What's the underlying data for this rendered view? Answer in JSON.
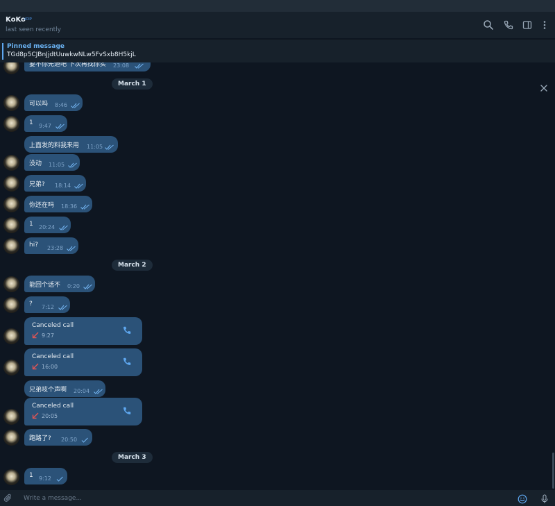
{
  "header": {
    "name": "KoKo",
    "badge": "VOIP",
    "status": "last seen recently"
  },
  "pinned": {
    "title": "Pinned message",
    "text": "TGd8p5CJBnJjdtUuwkwNLw5FvSxb8H5kjL"
  },
  "dates": [
    "March 1",
    "March 2",
    "March 3"
  ],
  "messages": [
    {
      "text": "要不你先退吧 下次再找你买",
      "time": "23:08"
    },
    {
      "text": "可以吗",
      "time": "8:46"
    },
    {
      "text": "1",
      "time": "9:47"
    },
    {
      "text": "上面发的料我来用",
      "time": "11:05"
    },
    {
      "text": "没动",
      "time": "11:05"
    },
    {
      "text": "兄弟?",
      "time": "18:14"
    },
    {
      "text": "你还在吗",
      "time": "18:36"
    },
    {
      "text": "1",
      "time": "20:24"
    },
    {
      "text": "hi?",
      "time": "23:28"
    },
    {
      "text": "能回个话不",
      "time": "0:20"
    },
    {
      "text": "?",
      "time": "7:12"
    },
    {
      "text": "兄弟吱个声啊",
      "time": "20:04"
    },
    {
      "text": "跑路了?",
      "time": "20:50"
    },
    {
      "text": "1",
      "time": "9:12"
    }
  ],
  "calls": [
    {
      "label": "Canceled call",
      "time": "9:27"
    },
    {
      "label": "Canceled call",
      "time": "16:00"
    },
    {
      "label": "Canceled call",
      "time": "20:05"
    }
  ],
  "composer": {
    "placeholder": "Write a message..."
  },
  "icons": {
    "search": "search-icon",
    "phone": "phone-icon",
    "sidebar": "sidebar-toggle-icon",
    "menu": "more-vertical-icon",
    "close": "close-icon",
    "attach": "paperclip-icon",
    "emoji": "emoji-icon",
    "mic": "microphone-icon"
  },
  "colors": {
    "background": "#0e1621",
    "bubble": "#2b5278",
    "accent": "#5ea7f0",
    "missed_call": "#e05555"
  }
}
